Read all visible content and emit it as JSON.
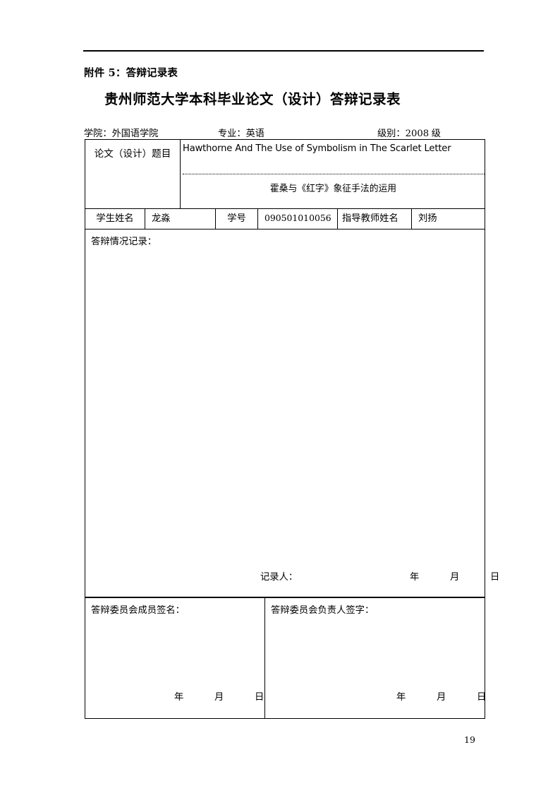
{
  "document": {
    "attachment_label": "附件 5：答辩记录表",
    "title": "贵州师范大学本科毕业论文（设计）答辩记录表",
    "page_number": "19"
  },
  "meta": {
    "college_label": "学院：",
    "college_value": "外国语学院",
    "major_label": "专业：",
    "major_value": "英语",
    "grade_label": "级别：",
    "grade_value": "2008",
    "grade_suffix": "级"
  },
  "table": {
    "thesis_title_label": "论文（设计）题目",
    "thesis_title_en": "Hawthorne And The Use of Symbolism in The Scarlet Letter",
    "thesis_title_cn": "霍桑与《红字》象征手法的运用",
    "student_row": {
      "name_label": "学生姓名",
      "name_value": "龙淼",
      "id_label": "学号",
      "id_value": "090501010056",
      "advisor_label": "指导教师姓名",
      "advisor_value": "刘扬"
    },
    "record_label": "答辩情况记录：",
    "recorder_label": "记录人：",
    "date_line": "年    月    日",
    "committee_members_label": "答辩委员会成员签名：",
    "committee_head_label": "答辩委员会负责人签字："
  }
}
